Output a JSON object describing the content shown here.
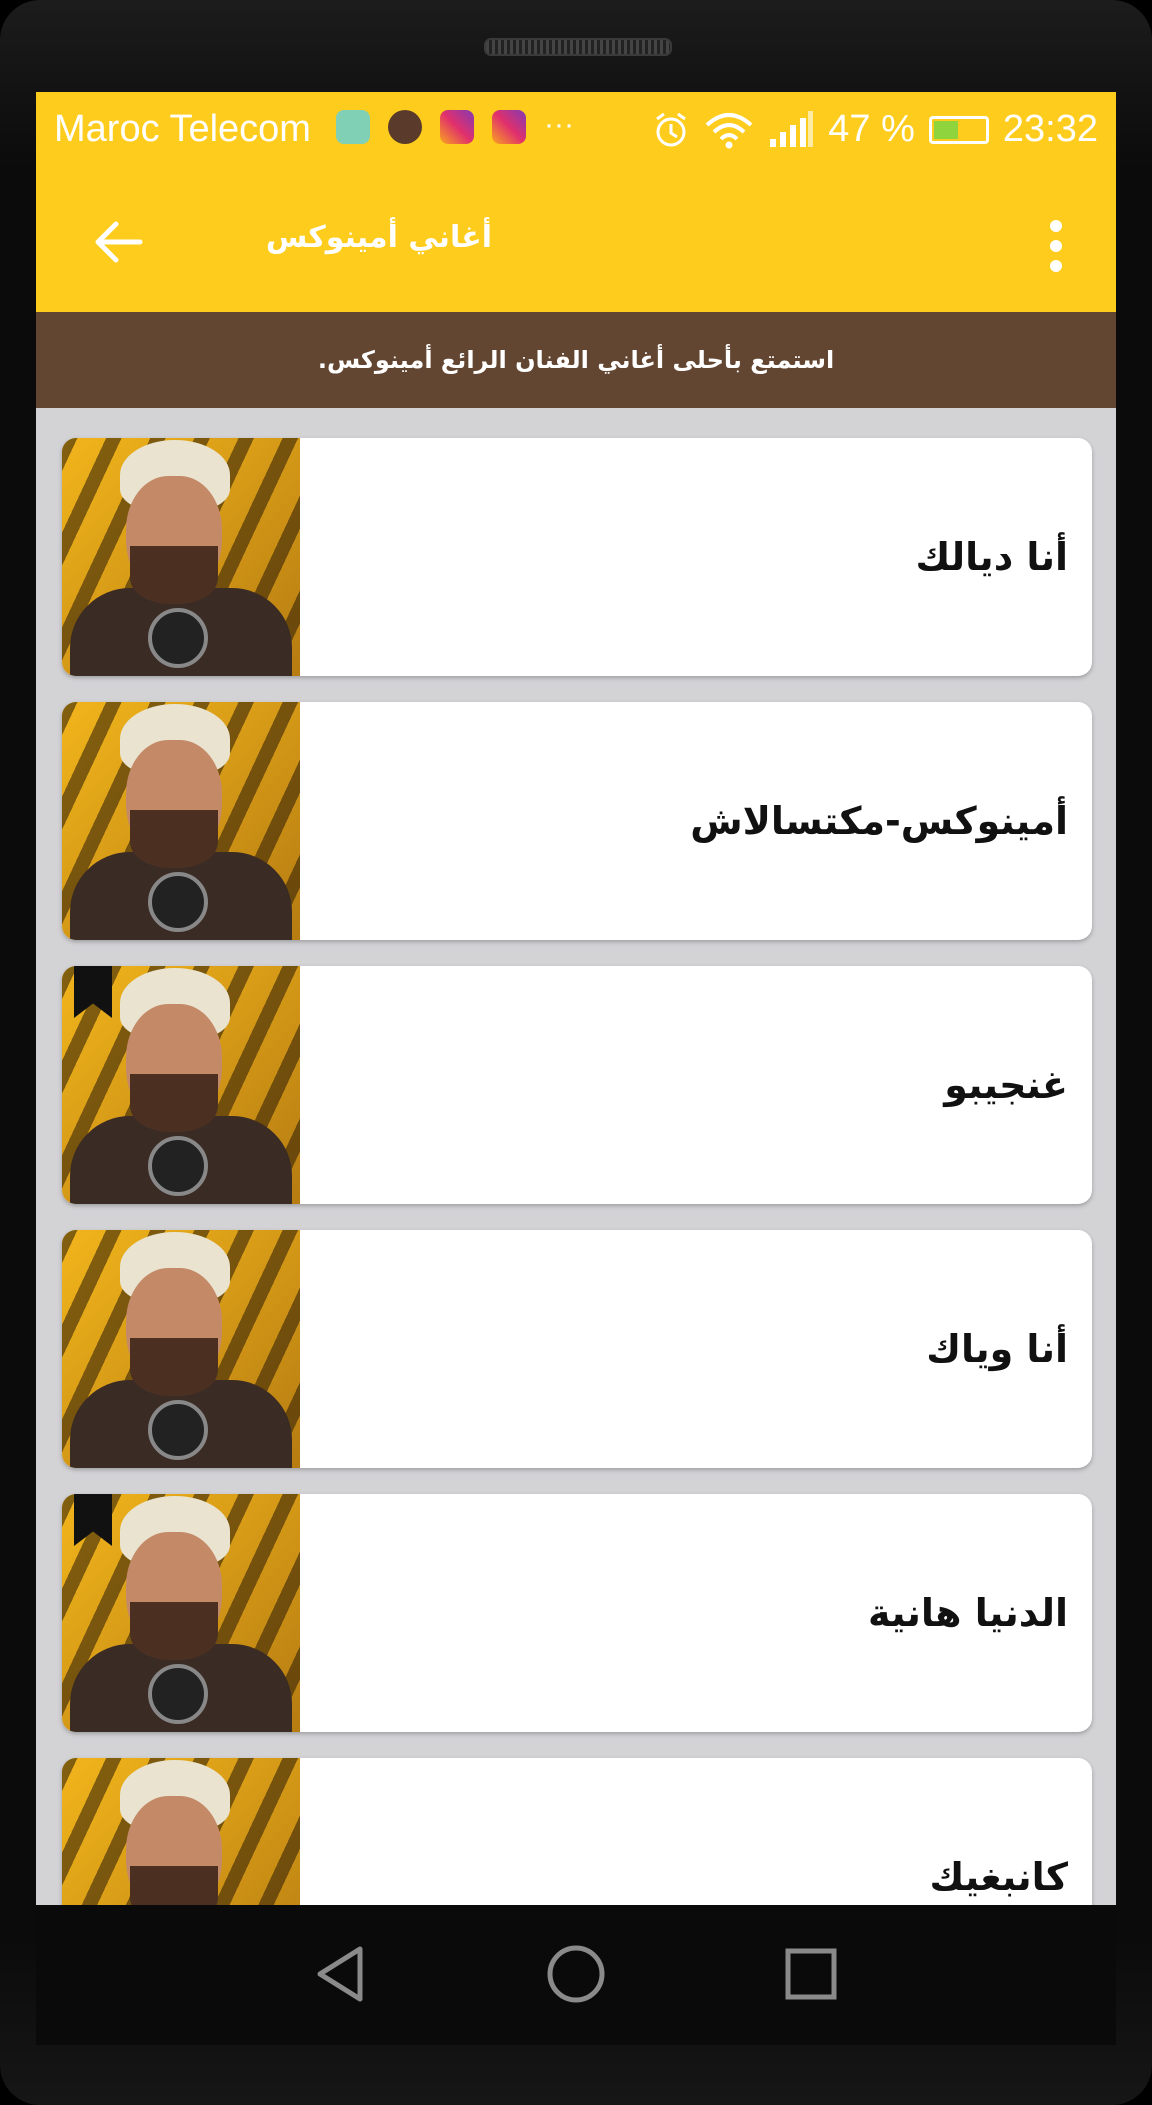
{
  "status_bar": {
    "carrier": "Maroc Telecom",
    "battery_level_percent": 47,
    "battery_text": "47 %",
    "time": "23:32",
    "more_indicator": "···",
    "icons": [
      "android-debug-icon",
      "fox-app-icon",
      "instagram-icon",
      "instagram-icon",
      "alarm-icon",
      "wifi-icon",
      "signal-icon",
      "battery-charging-icon"
    ]
  },
  "toolbar": {
    "title": "أغاني أمينوكس",
    "back_icon": "arrow-left-icon",
    "menu_icon": "more-vert-icon",
    "color": "#fecc1d"
  },
  "banner": {
    "text": "استمتع بأحلى أغاني الفنان الرائع أمينوكس.",
    "color": "#634631"
  },
  "songs": [
    {
      "title": "أنا ديالك",
      "bookmarked": false
    },
    {
      "title": "أمينوكس-مكتسالاش",
      "bookmarked": false
    },
    {
      "title": "غنجيبو",
      "bookmarked": true
    },
    {
      "title": "أنا وياك",
      "bookmarked": false
    },
    {
      "title": "الدنيا هانية",
      "bookmarked": true
    },
    {
      "title": "كانبغيك",
      "bookmarked": false
    }
  ],
  "navbar": {
    "back": "nav-back-icon",
    "home": "nav-home-icon",
    "recents": "nav-recents-icon"
  }
}
